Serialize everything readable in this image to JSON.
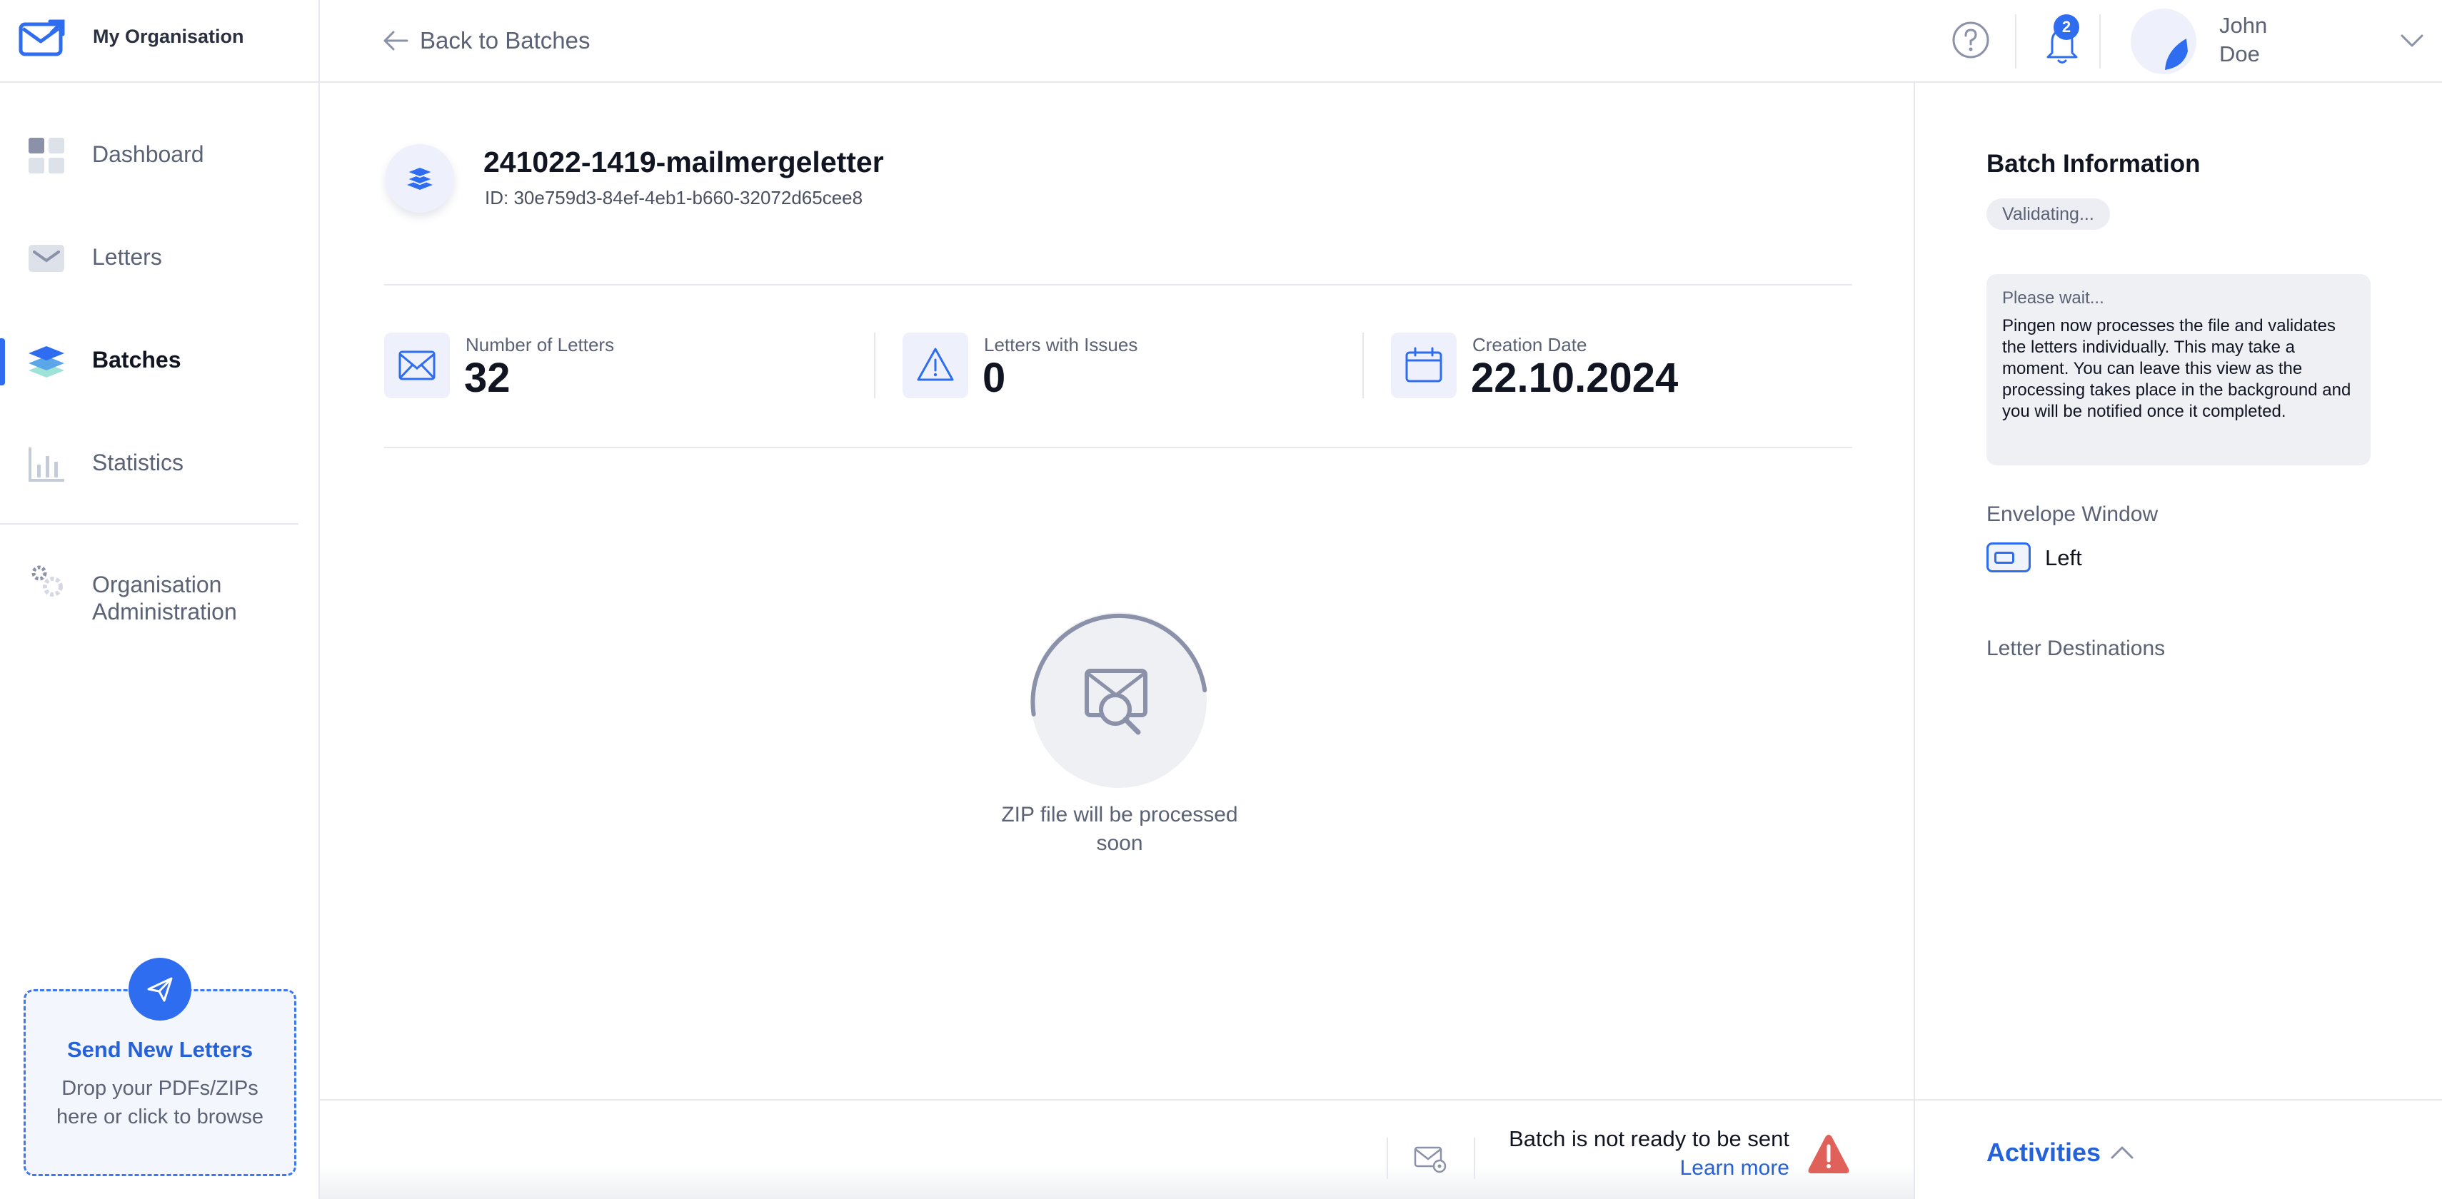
{
  "org": {
    "name": "My Organisation"
  },
  "nav": {
    "items": [
      {
        "label": "Dashboard",
        "icon": "dashboard-icon"
      },
      {
        "label": "Letters",
        "icon": "letters-icon"
      },
      {
        "label": "Batches",
        "icon": "batches-icon",
        "active": true
      },
      {
        "label": "Statistics",
        "icon": "statistics-icon"
      },
      {
        "label": "Organisation\nAdministration",
        "icon": "gear-icon"
      }
    ]
  },
  "send": {
    "title": "Send New Letters",
    "subtitle": "Drop your PDFs/ZIPs here or click to browse"
  },
  "topbar": {
    "back_label": "Back to Batches",
    "notifications_count": "2",
    "user_first": "John",
    "user_last": "Doe"
  },
  "batch": {
    "title": "241022-1419-mailmergeletter",
    "id": "ID: 30e759d3-84ef-4eb1-b660-32072d65cee8"
  },
  "stats": [
    {
      "label": "Number of Letters",
      "value": "32",
      "icon": "envelope-icon"
    },
    {
      "label": "Letters with Issues",
      "value": "0",
      "icon": "warning-triangle-icon"
    },
    {
      "label": "Creation Date",
      "value": "22.10.2024",
      "icon": "calendar-icon"
    }
  ],
  "processing": {
    "text": "ZIP file will be processed soon"
  },
  "panel": {
    "title": "Batch Information",
    "status": "Validating...",
    "info_title": "Please wait...",
    "info_body": "Pingen now processes the file and validates the letters individually. This may take a moment. You can leave this view as the processing takes place in the background and you will be notified once it completed.",
    "envelope_label": "Envelope Window",
    "envelope_value": "Left",
    "destinations_label": "Letter Destinations"
  },
  "footer": {
    "not_ready": "Batch is not ready to be sent",
    "learn_more": "Learn more",
    "activities": "Activities"
  },
  "colors": {
    "accent": "#2f6df0",
    "warning": "#e0605a"
  }
}
